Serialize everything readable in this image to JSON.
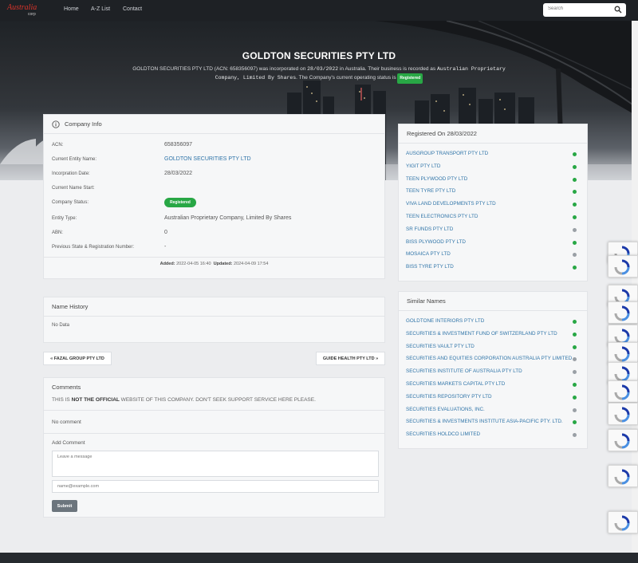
{
  "header": {
    "logo_text": "Australia",
    "logo_sub": "corp",
    "nav": [
      "Home",
      "A-Z List",
      "Contact"
    ],
    "search_placeholder": "Search"
  },
  "hero": {
    "title": "GOLDTON SECURITIES PTY LTD",
    "line1_a": "GOLDTON SECURITIES PTY LTD (ACN: 658356097) was incorporated on ",
    "line1_date": "28/03/2022",
    "line1_b": " in Australia. Their business is recorded as ",
    "line1_type": "Australian Proprietary Company, Limited By Shares",
    "line1_c": ". The Company's current operating status is ",
    "status": "Registered"
  },
  "company_info": {
    "title": "Company Info",
    "rows": [
      {
        "label": "ACN:",
        "value": "658356097"
      },
      {
        "label": "Current Entity Name:",
        "value": "GOLDTON SECURITIES PTY LTD"
      },
      {
        "label": "Incorpration Date:",
        "value": "28/03/2022"
      },
      {
        "label": "Current Name Start:",
        "value": ""
      },
      {
        "label": "Company Status:",
        "value": "Registered"
      },
      {
        "label": "Entity Type:",
        "value": "Australian Proprietary Company, Limited By Shares"
      },
      {
        "label": "ABN:",
        "value": "0"
      },
      {
        "label": "Previous State & Registration Number:",
        "value": "-"
      }
    ],
    "added_label": "Added:",
    "added": "2022-04-05 16:40",
    "updated_label": "Updated:",
    "updated": "2024-04-09 17:54"
  },
  "name_history": {
    "title": "Name History",
    "empty": "No Data"
  },
  "pager": {
    "prev": "« FAZAL GROUP PTY LTD",
    "next": "GUIDE HEALTH PTY LTD »"
  },
  "comments": {
    "title": "Comments",
    "note_a": "THIS IS ",
    "note_b": "NOT THE OFFICIAL",
    "note_c": " WEBSITE OF THIS COMPANY. DON'T SEEK SUPPORT SERVICE HERE PLEASE.",
    "no_comment": "No comment",
    "add_comment": "Add Comment",
    "message_placeholder": "Leave a message",
    "email_placeholder": "name@example.com",
    "submit": "Submit"
  },
  "registered_on": {
    "title": "Registered On 28/03/2022",
    "items": [
      {
        "name": "AUSGROUP TRANSPORT PTY LTD",
        "status": "green"
      },
      {
        "name": "YIGIT PTY LTD",
        "status": "green"
      },
      {
        "name": "TEEN PLYWOOD PTY LTD",
        "status": "green"
      },
      {
        "name": "TEEN TYRE PTY LTD",
        "status": "green"
      },
      {
        "name": "VIVA LAND DEVELOPMENTS PTY LTD",
        "status": "green"
      },
      {
        "name": "TEEN ELECTRONICS PTY LTD",
        "status": "green"
      },
      {
        "name": "SR FUNDS PTY LTD",
        "status": "gray"
      },
      {
        "name": "BISS PLYWOOD PTY LTD",
        "status": "green"
      },
      {
        "name": "MOSAICA PTY LTD",
        "status": "gray"
      },
      {
        "name": "BISS TYRE PTY LTD",
        "status": "green"
      }
    ]
  },
  "similar_names": {
    "title": "Similar Names",
    "items": [
      {
        "name": "GOLDTONE INTERIORS PTY LTD",
        "status": "green"
      },
      {
        "name": "SECURITIES & INVESTMENT FUND OF SWITZERLAND PTY LTD",
        "status": "green"
      },
      {
        "name": "SECURITIES VAULT PTY LTD",
        "status": "green"
      },
      {
        "name": "SECURITIES AND EQUITIES CORPORATION AUSTRALIA PTY LIMITED",
        "status": "gray"
      },
      {
        "name": "SECURITIES INSTITUTE OF AUSTRALIA PTY LTD",
        "status": "gray"
      },
      {
        "name": "SECURITIES MARKETS CAPITAL PTY LTD",
        "status": "green"
      },
      {
        "name": "SECURITIES REPOSITORY PTY LTD",
        "status": "green"
      },
      {
        "name": "SECURITIES EVALUATIONS, INC.",
        "status": "gray"
      },
      {
        "name": "SECURITIES & INVESTMENTS INSTITUTE ASIA-PACIFIC PTY. LTD.",
        "status": "green"
      },
      {
        "name": "SECURITIES HOLDCO LIMITED",
        "status": "gray"
      }
    ]
  },
  "colors": {
    "green": "#28a745",
    "gray": "#9aa0a6",
    "link": "#2f74a8"
  }
}
